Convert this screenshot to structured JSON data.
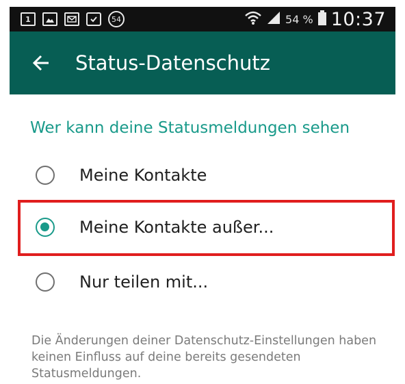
{
  "status_bar": {
    "notification_icons": [
      {
        "name": "sim-notification-icon",
        "text": "1"
      },
      {
        "name": "image-notification-icon",
        "text": ""
      },
      {
        "name": "mail-notification-icon",
        "text": ""
      },
      {
        "name": "bag-notification-icon",
        "text": ""
      }
    ],
    "badge_count": "54",
    "battery_percent": "54 %",
    "time": "10:37"
  },
  "toolbar": {
    "back_icon": "arrow-left-icon",
    "title": "Status-Datenschutz",
    "background_color": "#075e54"
  },
  "content": {
    "section_header": "Wer kann deine Statusmeldungen sehen",
    "accent_color": "#199a8a",
    "options": [
      {
        "label": "Meine Kontakte",
        "selected": false
      },
      {
        "label": "Meine Kontakte außer...",
        "selected": true
      },
      {
        "label": "Nur teilen mit...",
        "selected": false
      }
    ],
    "highlight_color": "#e01e1e",
    "footer_note": "Die Änderungen deiner Datenschutz-Einstellungen haben keinen Einfluss auf deine bereits gesendeten Statusmeldungen."
  }
}
